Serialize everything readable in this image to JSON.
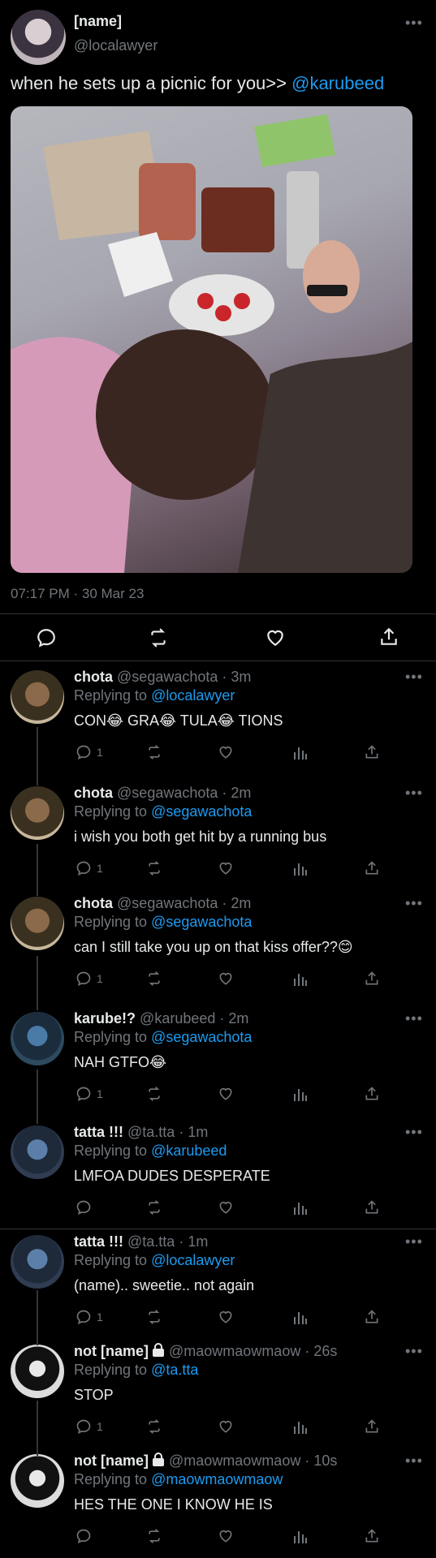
{
  "post": {
    "name": "[name]",
    "handle": "@localawyer",
    "text": "when he sets up a picnic for you>> ",
    "mention": "@karubeed",
    "timestamp": "07:17 PM · 30 Mar 23",
    "icons": [
      "reply-icon",
      "retweet-icon",
      "like-icon",
      "share-icon"
    ]
  },
  "replies": [
    {
      "name": "chota",
      "handle": "@segawachota",
      "time": "· 3m",
      "replying_prefix": "Replying to ",
      "replying_to": "@localawyer",
      "text": "CON😂 GRA😂 TULA😂 TIONS",
      "reply_count": "1"
    },
    {
      "name": "chota",
      "handle": "@segawachota",
      "time": "· 2m",
      "replying_prefix": "Replying to ",
      "replying_to": "@segawachota",
      "text": "i wish you both get hit by a running bus",
      "reply_count": "1"
    },
    {
      "name": "chota",
      "handle": "@segawachota",
      "time": "· 2m",
      "replying_prefix": "Replying to ",
      "replying_to": "@segawachota",
      "text": "can I still take you up on that kiss offer??😊",
      "reply_count": "1"
    },
    {
      "name": "karube!?",
      "handle": "@karubeed",
      "time": "· 2m",
      "replying_prefix": "Replying to ",
      "replying_to": "@segawachota",
      "text": "NAH GTFO😂",
      "reply_count": "1"
    },
    {
      "name": "tatta !!!",
      "handle": "@ta.tta",
      "time": "· 1m",
      "replying_prefix": "Replying to ",
      "replying_to": "@karubeed",
      "text": "LMFOA DUDES DESPERATE",
      "reply_count": ""
    },
    {
      "name": "tatta !!!",
      "handle": "@ta.tta",
      "time": "· 1m",
      "replying_prefix": "Replying to ",
      "replying_to": "@localawyer",
      "text": "(name).. sweetie.. not again",
      "reply_count": "1"
    },
    {
      "name": "not [name]",
      "handle": "@maowmaowmaow",
      "time": "· 26s",
      "replying_prefix": "Replying to ",
      "replying_to": "@ta.tta",
      "text": "STOP",
      "reply_count": "1"
    },
    {
      "name": "not [name]",
      "handle": "@maowmaowmaow",
      "time": "· 10s",
      "replying_prefix": "Replying to ",
      "replying_to": "@maowmaowmaow",
      "text": "HES THE ONE I KNOW HE IS",
      "reply_count": ""
    }
  ],
  "colors": {
    "background": "#000000",
    "text": "#e7e9ea",
    "muted": "#71767b",
    "link": "#1d9bf0",
    "divider": "#2f3336"
  }
}
